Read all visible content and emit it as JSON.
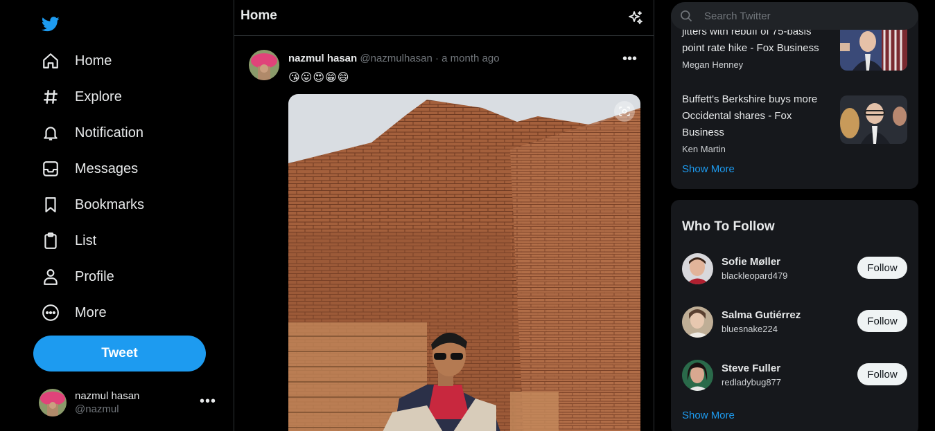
{
  "sidebar": {
    "logo": "twitter-bird-icon",
    "nav": [
      {
        "label": "Home",
        "icon": "home-icon"
      },
      {
        "label": "Explore",
        "icon": "hashtag-icon"
      },
      {
        "label": "Notification",
        "icon": "bell-icon"
      },
      {
        "label": "Messages",
        "icon": "inbox-icon"
      },
      {
        "label": "Bookmarks",
        "icon": "bookmark-icon"
      },
      {
        "label": "List",
        "icon": "clipboard-icon"
      },
      {
        "label": "Profile",
        "icon": "user-icon"
      },
      {
        "label": "More",
        "icon": "more-circle-icon"
      }
    ],
    "tweet_button": "Tweet",
    "account": {
      "name": "nazmul hasan",
      "handle": "@nazmul",
      "more": "•••"
    }
  },
  "feed": {
    "title": "Home",
    "tweet": {
      "name": "nazmul hasan",
      "handle": "@nazmulhasan",
      "time": "· a month ago",
      "more": "•••",
      "text": "😘😛😍😁😄"
    }
  },
  "right": {
    "search": {
      "placeholder": "Search Twitter"
    },
    "news": [
      {
        "headline": "jitters with rebuff of 75-basis point rate hike - Fox Business",
        "author": "Megan Henney"
      },
      {
        "headline": "Buffett's Berkshire buys more Occidental shares - Fox Business",
        "author": "Ken Martin"
      }
    ],
    "news_show_more": "Show More",
    "who_to_follow": {
      "title": "Who To Follow",
      "users": [
        {
          "name": "Sofie Møller",
          "handle": "blackleopard479",
          "button": "Follow"
        },
        {
          "name": "Salma Gutiérrez",
          "handle": "bluesnake224",
          "button": "Follow"
        },
        {
          "name": "Steve Fuller",
          "handle": "redladybug877",
          "button": "Follow"
        }
      ],
      "show_more": "Show More"
    }
  },
  "colors": {
    "accent": "#1d9bf0",
    "background": "#000000",
    "panel": "#16181c",
    "muted": "#71767b"
  }
}
